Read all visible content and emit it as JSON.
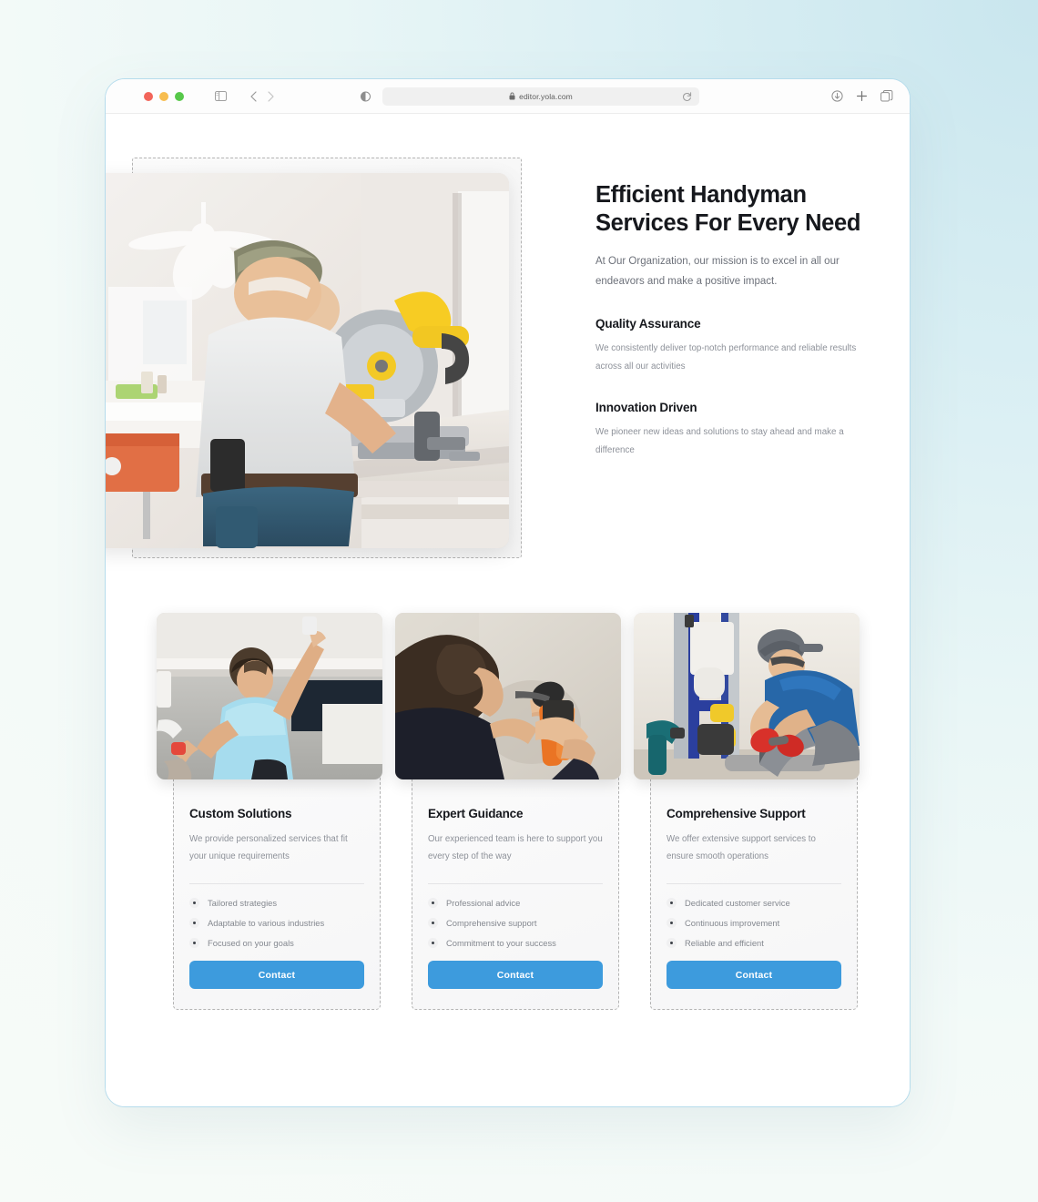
{
  "browser": {
    "url": "editor.yola.com",
    "traffic_lights": [
      "close",
      "minimize",
      "maximize"
    ],
    "icons": {
      "sidebar": "sidebar-toggle-icon",
      "back": "chevron-left-icon",
      "forward": "chevron-right-icon",
      "reader": "reader-view-icon",
      "lock": "lock-icon",
      "reload": "reload-icon",
      "download": "download-icon",
      "new_tab": "plus-icon",
      "tab_overview": "tab-overview-icon"
    }
  },
  "hero": {
    "title": "Efficient Handyman Services For Every Need",
    "subtitle": "At Our Organization, our mission is to excel in all our endeavors and make a positive impact.",
    "image_alt": "two-handymen-cutting-trim-with-miter-saw",
    "features": [
      {
        "title": "Quality Assurance",
        "desc": "We consistently deliver top-notch performance and reliable results across all our activities"
      },
      {
        "title": "Innovation Driven",
        "desc": "We pioneer new ideas and solutions to stay ahead and make a difference"
      }
    ]
  },
  "cards": [
    {
      "title": "Custom Solutions",
      "desc": "We provide personalized services that fit your unique requirements",
      "image_alt": "man-painting-ceiling-with-roller",
      "items": [
        "Tailored strategies",
        "Adaptable to various industries",
        "Focused on your goals"
      ],
      "button": "Contact"
    },
    {
      "title": "Expert Guidance",
      "desc": "Our experienced team is here to support you every step of the way",
      "image_alt": "man-using-wire-crimping-pliers-on-wall-outlet",
      "items": [
        "Professional advice",
        "Comprehensive support",
        "Commitment to your success"
      ],
      "button": "Contact"
    },
    {
      "title": "Comprehensive Support",
      "desc": "We offer extensive support services to ensure smooth operations",
      "image_alt": "plumber-in-blue-shirt-installing-pipes",
      "items": [
        "Dedicated customer service",
        "Continuous improvement",
        "Reliable and efficient"
      ],
      "button": "Contact"
    }
  ],
  "colors": {
    "accent_button": "#3d9bdd",
    "heading": "#16181d",
    "body_text": "#8d9199",
    "window_border": "#b6dcec",
    "dashed_outline": "#b4b4b4",
    "background_top_right": "#c9e6ee",
    "background_bottom_left": "#f7fbf8"
  }
}
